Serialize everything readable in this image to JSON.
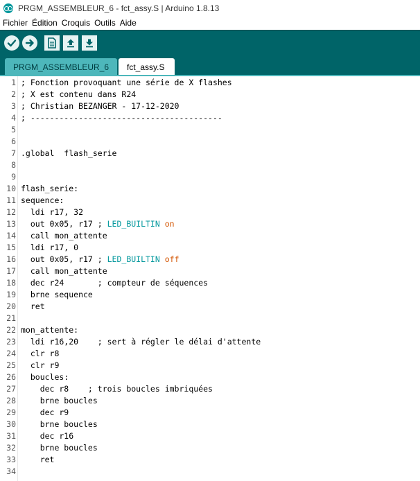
{
  "window": {
    "title": "PRGM_ASSEMBLEUR_6 - fct_assy.S | Arduino 1.8.13"
  },
  "menu": [
    "Fichier",
    "Édition",
    "Croquis",
    "Outils",
    "Aide"
  ],
  "toolbar": {
    "buttons": [
      "verify-icon",
      "upload-icon",
      "new-icon",
      "open-icon",
      "save-icon"
    ],
    "colors": {
      "bar": "#006468",
      "button": "#e6f3f3"
    }
  },
  "tabs": [
    {
      "label": "PRGM_ASSEMBLEUR_6",
      "active": false
    },
    {
      "label": "fct_assy.S",
      "active": true
    }
  ],
  "editor": {
    "lines": [
      {
        "n": "1",
        "text": "; Fonction provoquant une série de X flashes"
      },
      {
        "n": "2",
        "text": "; X est contenu dans R24"
      },
      {
        "n": "3",
        "text": "; Christian BEZANGER - 17-12-2020"
      },
      {
        "n": "4",
        "text": "; ----------------------------------------"
      },
      {
        "n": "5",
        "text": ""
      },
      {
        "n": "6",
        "text": ""
      },
      {
        "n": "7",
        "text": ".global  flash_serie"
      },
      {
        "n": "8",
        "text": ""
      },
      {
        "n": "9",
        "text": ""
      },
      {
        "n": "10",
        "text": "flash_serie:"
      },
      {
        "n": "11",
        "text": "sequence:"
      },
      {
        "n": "12",
        "text": "  ldi r17, 32"
      },
      {
        "n": "13",
        "pre": "  out 0x05, r17 ; ",
        "kw1": "LED_BUILTIN",
        "sp": " ",
        "kw2": "on"
      },
      {
        "n": "14",
        "text": "  call mon_attente"
      },
      {
        "n": "15",
        "text": "  ldi r17, 0"
      },
      {
        "n": "16",
        "pre": "  out 0x05, r17 ; ",
        "kw1": "LED_BUILTIN",
        "sp": " ",
        "kw2": "off"
      },
      {
        "n": "17",
        "text": "  call mon_attente"
      },
      {
        "n": "18",
        "text": "  dec r24       ; compteur de séquences"
      },
      {
        "n": "19",
        "text": "  brne sequence"
      },
      {
        "n": "20",
        "text": "  ret"
      },
      {
        "n": "21",
        "text": ""
      },
      {
        "n": "22",
        "text": "mon_attente:"
      },
      {
        "n": "23",
        "text": "  ldi r16,20    ; sert à régler le délai d'attente"
      },
      {
        "n": "24",
        "text": "  clr r8"
      },
      {
        "n": "25",
        "text": "  clr r9"
      },
      {
        "n": "26",
        "text": "  boucles:"
      },
      {
        "n": "27",
        "text": "    dec r8    ; trois boucles imbriquées"
      },
      {
        "n": "28",
        "text": "    brne boucles"
      },
      {
        "n": "29",
        "text": "    dec r9"
      },
      {
        "n": "30",
        "text": "    brne boucles"
      },
      {
        "n": "31",
        "text": "    dec r16"
      },
      {
        "n": "32",
        "text": "    brne boucles"
      },
      {
        "n": "33",
        "text": "    ret"
      },
      {
        "n": "34",
        "text": ""
      }
    ],
    "colors": {
      "keyword": "#00979c",
      "literal": "#d35400"
    }
  }
}
